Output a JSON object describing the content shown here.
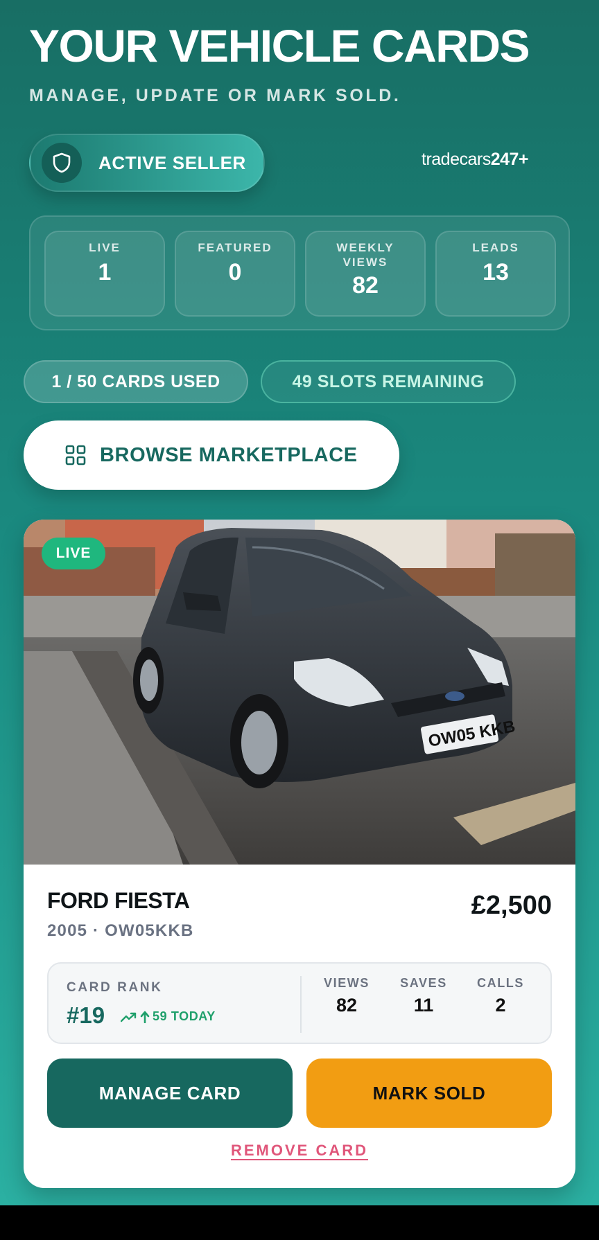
{
  "header": {
    "title": "YOUR VEHICLE CARDS",
    "subtitle": "MANAGE, UPDATE OR MARK SOLD."
  },
  "seller": {
    "badge_label": "ACTIVE SELLER",
    "icon": "shield-icon"
  },
  "brand": {
    "name": "tradecars",
    "suffix": "247+"
  },
  "stats": [
    {
      "label": "LIVE",
      "value": "1"
    },
    {
      "label": "FEATURED",
      "value": "0"
    },
    {
      "label": "WEEKLY VIEWS",
      "value": "82"
    },
    {
      "label": "LEADS",
      "value": "13"
    }
  ],
  "usage": {
    "cards_used": "1 / 50 CARDS USED",
    "slots_remaining": "49 SLOTS REMAINING"
  },
  "browse": {
    "label": "BROWSE MARKETPLACE",
    "icon": "grid-icon"
  },
  "vehicle": {
    "status_badge": "LIVE",
    "title": "FORD FIESTA",
    "meta": "2005 · OW05KKB",
    "price": "£2,500",
    "plate": "OW05 KKB",
    "rank_label": "CARD RANK",
    "rank_value": "#19",
    "rank_trend": "59 TODAY",
    "metrics": [
      {
        "label": "VIEWS",
        "value": "82"
      },
      {
        "label": "SAVES",
        "value": "11"
      },
      {
        "label": "CALLS",
        "value": "2"
      }
    ],
    "manage_label": "MANAGE CARD",
    "sold_label": "MARK SOLD",
    "remove_label": "REMOVE CARD"
  },
  "colors": {
    "brand_teal": "#17685f",
    "live_green": "#1fb77e",
    "sold_orange": "#f29d12",
    "remove_pink": "#e0567a"
  }
}
